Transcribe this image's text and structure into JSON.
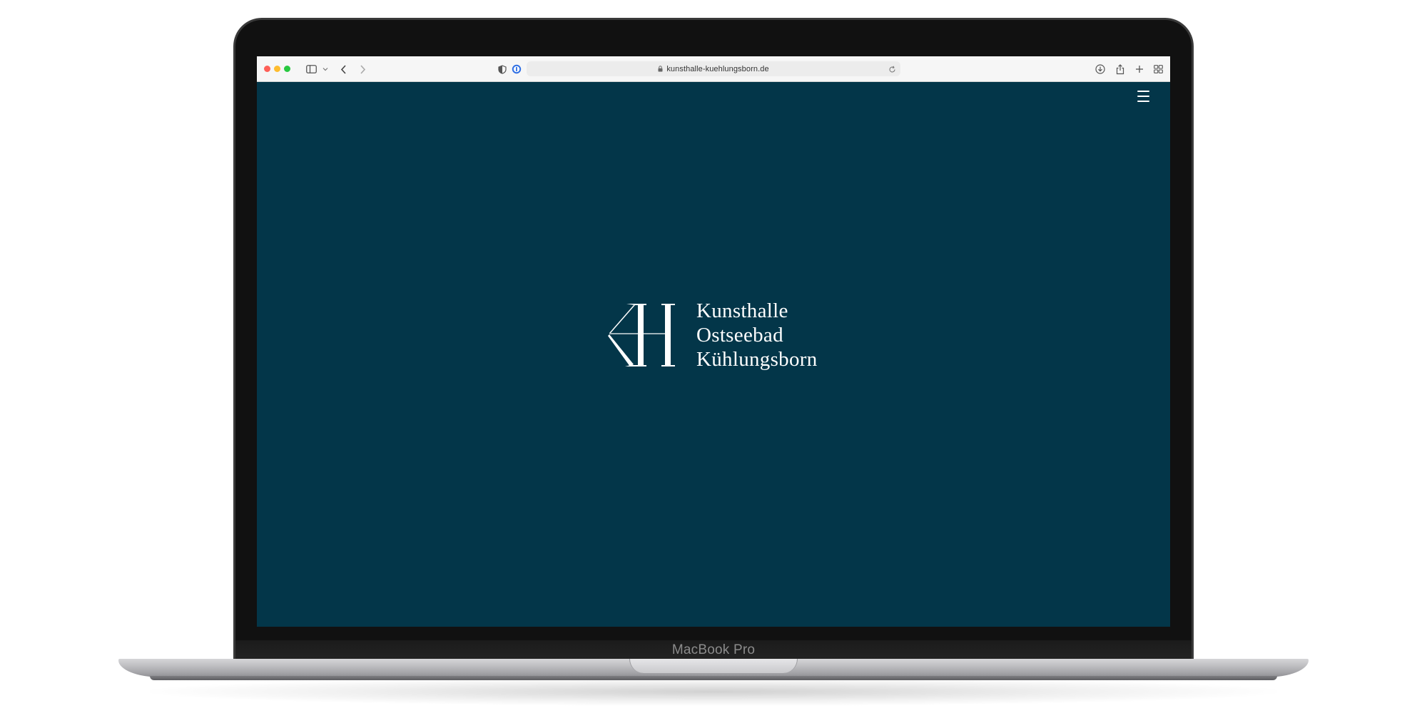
{
  "device": {
    "label": "MacBook Pro"
  },
  "browser": {
    "url": "kunsthalle-kuehlungsborn.de",
    "toolbar_icons": [
      "sidebar-icon",
      "chevron-down-icon",
      "back-icon",
      "forward-icon",
      "shield-icon",
      "password-icon",
      "lock-icon",
      "reload-icon",
      "download-icon",
      "share-icon",
      "new-tab-icon",
      "tab-overview-icon"
    ]
  },
  "page": {
    "background_color": "#033649",
    "menu_icon": "hamburger-menu-icon",
    "brand": {
      "line1": "Kunsthalle",
      "line2": "Ostseebad",
      "line3": "Kühlungsborn"
    }
  }
}
